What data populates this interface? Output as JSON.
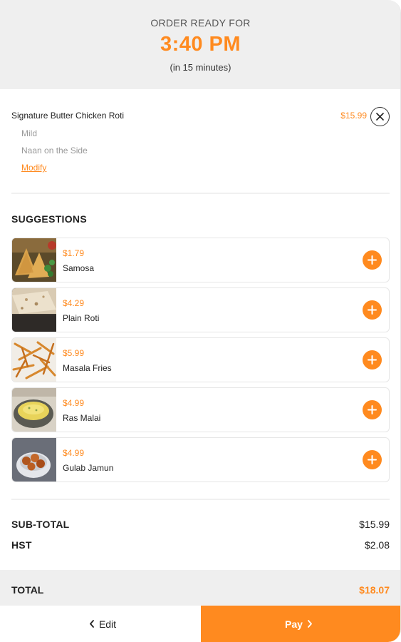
{
  "header": {
    "label": "ORDER READY FOR",
    "time": "3:40 PM",
    "eta": "(in 15 minutes)"
  },
  "order_item": {
    "name": "Signature Butter Chicken Roti",
    "price": "$15.99",
    "options": [
      "Mild",
      "Naan on the Side"
    ],
    "modify_label": "Modify",
    "remove_icon": "close-icon"
  },
  "suggestions": {
    "title": "SUGGESTIONS",
    "items": [
      {
        "price": "$1.79",
        "name": "Samosa"
      },
      {
        "price": "$4.29",
        "name": "Plain Roti"
      },
      {
        "price": "$5.99",
        "name": "Masala Fries"
      },
      {
        "price": "$4.99",
        "name": "Ras Malai"
      },
      {
        "price": "$4.99",
        "name": "Gulab Jamun"
      }
    ],
    "add_icon": "plus-icon"
  },
  "totals": {
    "subtotal_label": "SUB-TOTAL",
    "subtotal_value": "$15.99",
    "tax_label": "HST",
    "tax_value": "$2.08",
    "total_label": "TOTAL",
    "total_value": "$18.07"
  },
  "footer": {
    "edit_label": "Edit",
    "pay_label": "Pay"
  },
  "colors": {
    "accent": "#ff8a1f",
    "header_bg": "#efefef"
  }
}
